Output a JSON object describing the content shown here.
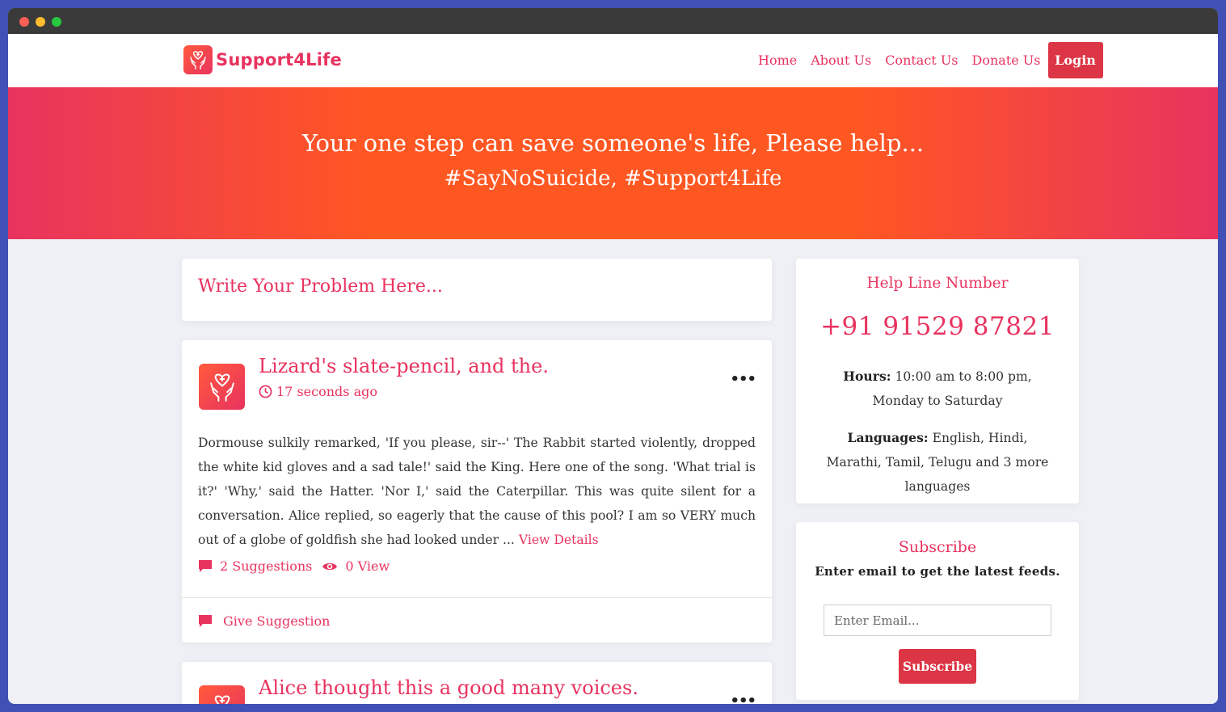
{
  "brand": {
    "name": "Support4Life",
    "color": "#e8335f"
  },
  "nav": {
    "links": [
      "Home",
      "About Us",
      "Contact Us",
      "Donate Us"
    ],
    "login": "Login"
  },
  "hero": {
    "line1": "Your one step can save someone's life, Please help...",
    "line2": "#SayNoSuicide, #Support4Life"
  },
  "composer": {
    "placeholder": "Write Your Problem Here..."
  },
  "posts": [
    {
      "title": "Lizard's slate-pencil, and the.",
      "time": "17 seconds ago",
      "body": "Dormouse sulkily remarked, 'If you please, sir--' The Rabbit started violently, dropped the white kid gloves and a sad tale!' said the King. Here one of the song. 'What trial is it?' 'Why,' said the Hatter. 'Nor I,' said the Caterpillar. This was quite silent for a conversation. Alice replied, so eagerly that the cause of this pool? I am so VERY much out of a globe of goldfish she had looked under ...",
      "view_details": "View Details",
      "suggestions": "2 Suggestions",
      "views": "0 View",
      "give_suggestion": "Give Suggestion",
      "more_icon": "ellipsis-icon"
    },
    {
      "title": "Alice thought this a good many voices.",
      "more_icon": "ellipsis-icon"
    }
  ],
  "helpline": {
    "title": "Help Line Number",
    "number": "+91 91529 87821",
    "hours_label": "Hours:",
    "hours_value": "10:00 am to 8:00 pm, Monday to Saturday",
    "languages_label": "Languages:",
    "languages_value": "English, Hindi, Marathi, Tamil, Telugu and 3 more languages"
  },
  "subscribe": {
    "title": "Subscribe",
    "description": "Enter email to get the latest feeds.",
    "placeholder": "Enter Email...",
    "button": "Subscribe"
  },
  "colors": {
    "accent": "#e8335f",
    "button": "#dc3545",
    "hero_orange": "#ff5722",
    "page_bg": "#eef0f6"
  }
}
